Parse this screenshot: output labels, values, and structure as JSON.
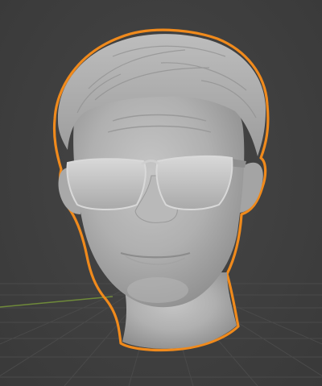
{
  "viewport": {
    "background_color": "#3d3d3d",
    "grid_color": "#4a4a4a",
    "x_axis_color": "#6f8a3a",
    "selection_outline_color": "#f08a1c",
    "mesh_color": "#b3b3b3",
    "selected_object": "head-sculpt-with-sunglasses"
  }
}
